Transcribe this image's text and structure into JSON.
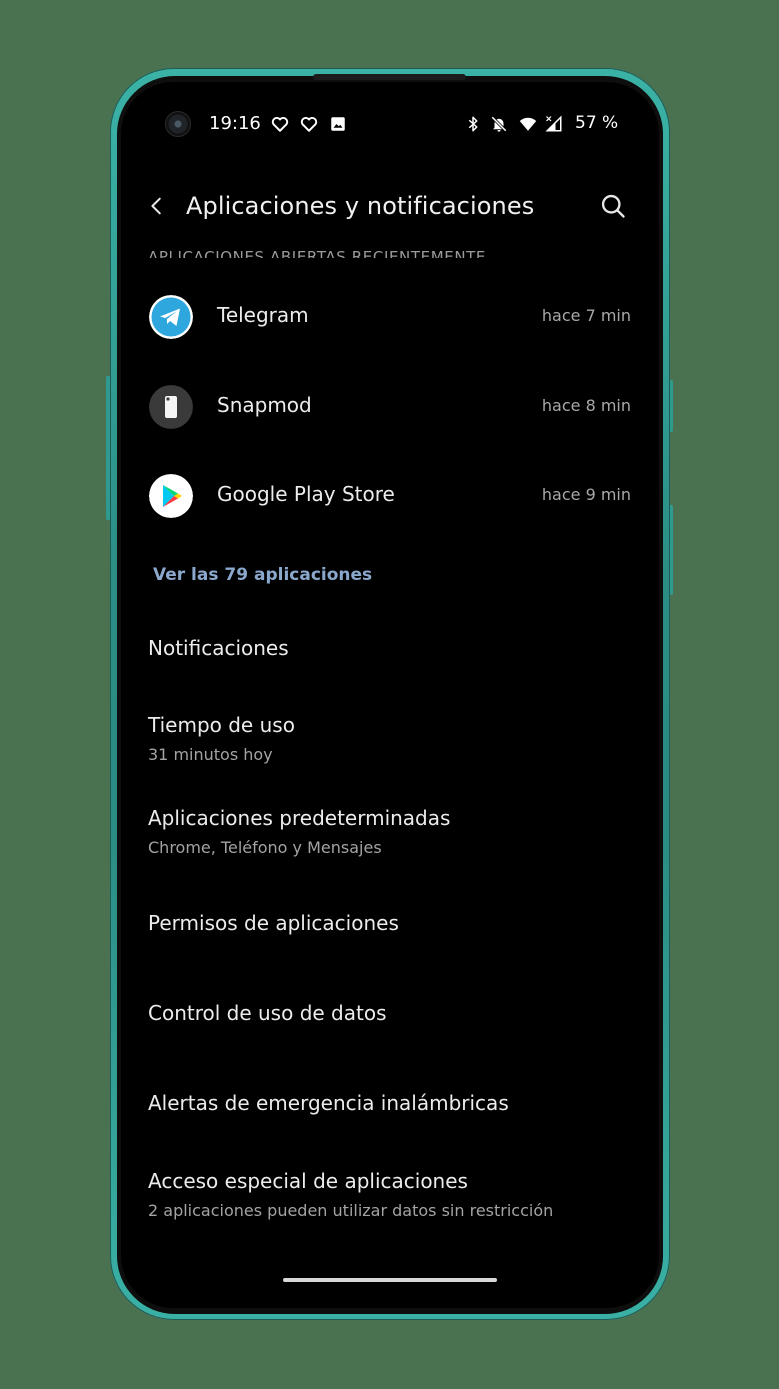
{
  "status_bar": {
    "time": "19:16",
    "battery": "57 %",
    "left_icons": [
      "heart-icon",
      "heart-icon",
      "image-icon"
    ],
    "right_icons": [
      "bluetooth-icon",
      "bell-off-icon",
      "wifi-icon",
      "signal-icon"
    ]
  },
  "app_bar": {
    "title": "Aplicaciones y notificaciones",
    "back_icon": "arrow-back-icon",
    "search_icon": "search-icon"
  },
  "recent_apps": {
    "header": "APLICACIONES ABIERTAS RECIENTEMENTE",
    "items": [
      {
        "name": "Telegram",
        "time": "hace 7 min",
        "icon": "telegram-icon"
      },
      {
        "name": "Snapmod",
        "time": "hace 8 min",
        "icon": "phone-icon"
      },
      {
        "name": "Google Play Store",
        "time": "hace 9 min",
        "icon": "play-store-icon"
      }
    ],
    "see_all": "Ver las 79 aplicaciones"
  },
  "settings": [
    {
      "title": "Notificaciones",
      "subtitle": ""
    },
    {
      "title": "Tiempo de uso",
      "subtitle": "31 minutos hoy"
    },
    {
      "title": "Aplicaciones predeterminadas",
      "subtitle": "Chrome, Teléfono y Mensajes"
    },
    {
      "title": "Permisos de aplicaciones",
      "subtitle": ""
    },
    {
      "title": "Control de uso de datos",
      "subtitle": ""
    },
    {
      "title": "Alertas de emergencia inalámbricas",
      "subtitle": ""
    },
    {
      "title": "Acceso especial de aplicaciones",
      "subtitle": "2 aplicaciones pueden utilizar datos sin restricción"
    }
  ],
  "colors": {
    "background": "#000000",
    "accent_link": "#8aa7cc",
    "phone_frame": "#2f9b90",
    "telegram": "#2ea6de"
  }
}
